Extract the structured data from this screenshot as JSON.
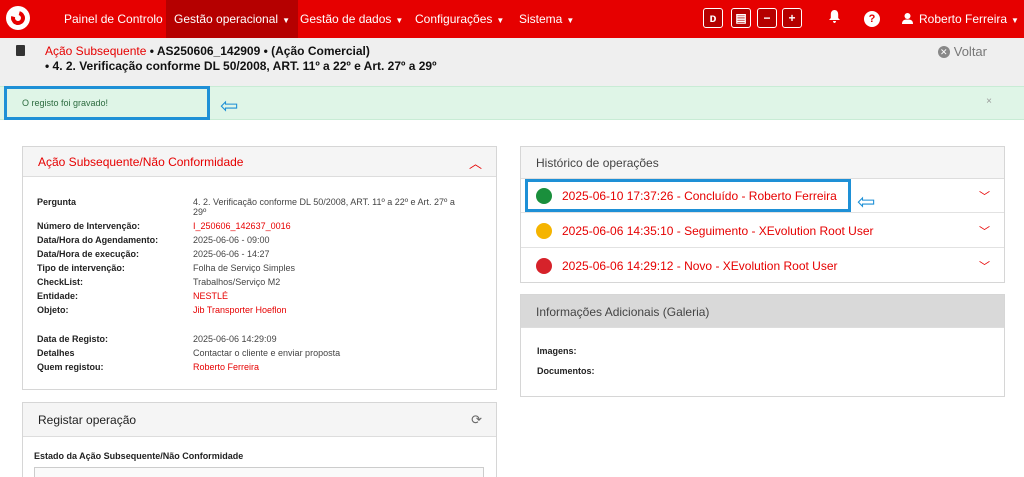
{
  "nav": {
    "items": [
      {
        "label": "Painel de Controlo",
        "caret": ""
      },
      {
        "label": "Gestão operacional",
        "caret": "▼"
      },
      {
        "label": "Gestão de dados",
        "caret": "▼"
      },
      {
        "label": "Configurações",
        "caret": "▼"
      },
      {
        "label": "Sistema",
        "caret": "▼"
      }
    ],
    "buttons": {
      "chat": "ᴅ",
      "card": "▤",
      "minus": "−",
      "plus": "+"
    },
    "help": "?",
    "user": "Roberto Ferreira",
    "user_caret": "▼",
    "colors": {
      "brand": "#e60000",
      "active": "#b50000"
    }
  },
  "header": {
    "link": "Ação Subsequente",
    "line1_rest": " • AS250606_142909 • (Ação Comercial)",
    "line2": "• 4. 2. Verificação conforme DL 50/2008, ART. 11º a 22º e Art. 27º a 29º",
    "back_label": "Voltar"
  },
  "alert": {
    "message": "O registo foi gravado!",
    "close": "×"
  },
  "nc_panel": {
    "title": "Ação Subsequente/Não Conformidade",
    "fields": [
      {
        "key": "Pergunta",
        "value": "4. 2. Verificação conforme DL 50/2008, ART. 11º a 22º e Art. 27º a",
        "value2": "29º"
      },
      {
        "key": "Número de Intervenção:",
        "value": "I_250606_142637_0016"
      },
      {
        "key": "Data/Hora do Agendamento:",
        "value": "2025-06-06 - 09:00"
      },
      {
        "key": "Data/Hora de execução:",
        "value": "2025-06-06 - 14:27"
      },
      {
        "key": "Tipo de intervenção:",
        "value": "Folha de Serviço Simples"
      },
      {
        "key": "CheckList:",
        "value": "Trabalhos/Serviço M2"
      },
      {
        "key": "Entidade:",
        "value": "NESTLÉ"
      },
      {
        "key": "Objeto:",
        "value": "Jib Transporter Hoeflon"
      },
      {
        "key": "Data de Registo:",
        "value": "2025-06-06 14:29:09"
      },
      {
        "key": "Detalhes",
        "value": "Contactar o cliente e enviar proposta"
      },
      {
        "key": "Quem registou:",
        "value": "Roberto Ferreira"
      }
    ]
  },
  "register_panel": {
    "title": "Registar operação",
    "state_label": "Estado da Ação Subsequente/Não Conformidade"
  },
  "history": {
    "title": "Histórico de operações",
    "operations": [
      {
        "text": "2025-06-10 17:37:26 - Concluído - Roberto Ferreira",
        "color": "#1a8f3c"
      },
      {
        "text": "2025-06-06 14:35:10 - Seguimento - XEvolution Root User",
        "color": "#f5b400"
      },
      {
        "text": "2025-06-06 14:29:12 - Novo - XEvolution Root User",
        "color": "#d6222a"
      }
    ]
  },
  "gallery": {
    "title": "Informações Adicionais (Galeria)",
    "images_label": "Imagens:",
    "documents_label": "Documentos:"
  }
}
